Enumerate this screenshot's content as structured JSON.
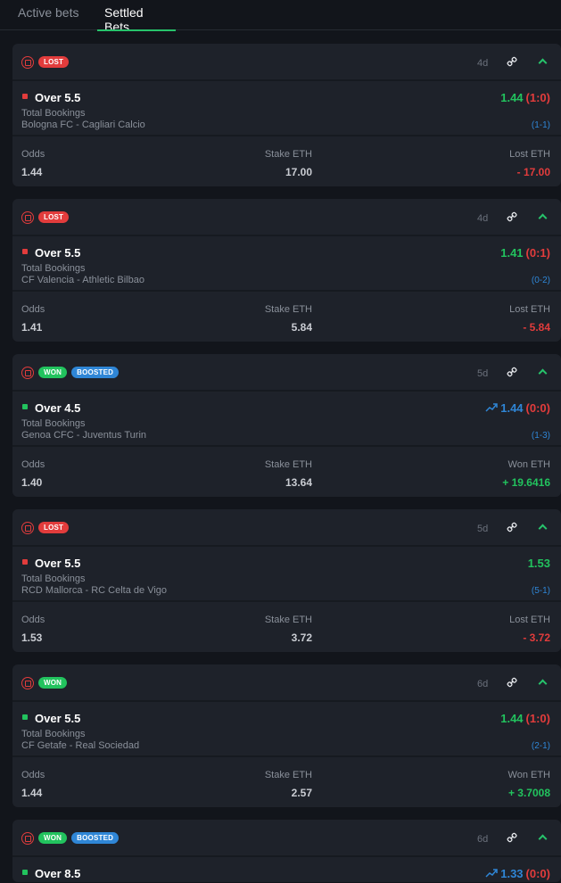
{
  "tabs": [
    {
      "label": "Active bets",
      "active": false
    },
    {
      "label": "Settled Bets",
      "active": true
    }
  ],
  "stat_labels": {
    "odds": "Odds",
    "stake": "Stake ETH"
  },
  "bets": [
    {
      "status": "LOST",
      "boosted": false,
      "ago": "4d",
      "selection": "Over 5.5",
      "market": "Total Bookings",
      "match": "Bologna FC - Cagliari Calcio",
      "odds_display": "1.44",
      "live_score": "(1:0)",
      "final_score": "(1-1)",
      "odds": "1.44",
      "stake": "17.00",
      "result_label": "Lost ETH",
      "result_value": "- 17.00"
    },
    {
      "status": "LOST",
      "boosted": false,
      "ago": "4d",
      "selection": "Over 5.5",
      "market": "Total Bookings",
      "match": "CF Valencia - Athletic Bilbao",
      "odds_display": "1.41",
      "live_score": "(0:1)",
      "final_score": "(0-2)",
      "odds": "1.41",
      "stake": "5.84",
      "result_label": "Lost ETH",
      "result_value": "- 5.84"
    },
    {
      "status": "WON",
      "boosted": true,
      "ago": "5d",
      "selection": "Over 4.5",
      "market": "Total Bookings",
      "match": "Genoa CFC - Juventus Turin",
      "odds_display": "1.44",
      "live_score": "(0:0)",
      "final_score": "(1-3)",
      "odds": "1.40",
      "stake": "13.64",
      "result_label": "Won ETH",
      "result_value": "+ 19.6416"
    },
    {
      "status": "LOST",
      "boosted": false,
      "ago": "5d",
      "selection": "Over 5.5",
      "market": "Total Bookings",
      "match": "RCD Mallorca - RC Celta de Vigo",
      "odds_display": "1.53",
      "live_score": "",
      "final_score": "(5-1)",
      "odds": "1.53",
      "stake": "3.72",
      "result_label": "Lost ETH",
      "result_value": "- 3.72"
    },
    {
      "status": "WON",
      "boosted": false,
      "ago": "6d",
      "selection": "Over 5.5",
      "market": "Total Bookings",
      "match": "CF Getafe - Real Sociedad",
      "odds_display": "1.44",
      "live_score": "(1:0)",
      "final_score": "(2-1)",
      "odds": "1.44",
      "stake": "2.57",
      "result_label": "Won ETH",
      "result_value": "+ 3.7008"
    },
    {
      "status": "WON",
      "boosted": true,
      "ago": "6d",
      "selection": "Over 8.5",
      "odds_display": "1.33",
      "live_score": "(0:0)"
    }
  ],
  "badge_labels": {
    "lost": "LOST",
    "won": "WON",
    "boosted": "BOOSTED"
  },
  "icons": {
    "sport": "football-icon",
    "share": "link-icon",
    "collapse": "chevron-up-icon",
    "boost": "trend-up-icon"
  },
  "colors": {
    "win": "#22c35e",
    "loss": "#e23c3c",
    "boost": "#2f86d6",
    "accent": "#27c36b"
  }
}
